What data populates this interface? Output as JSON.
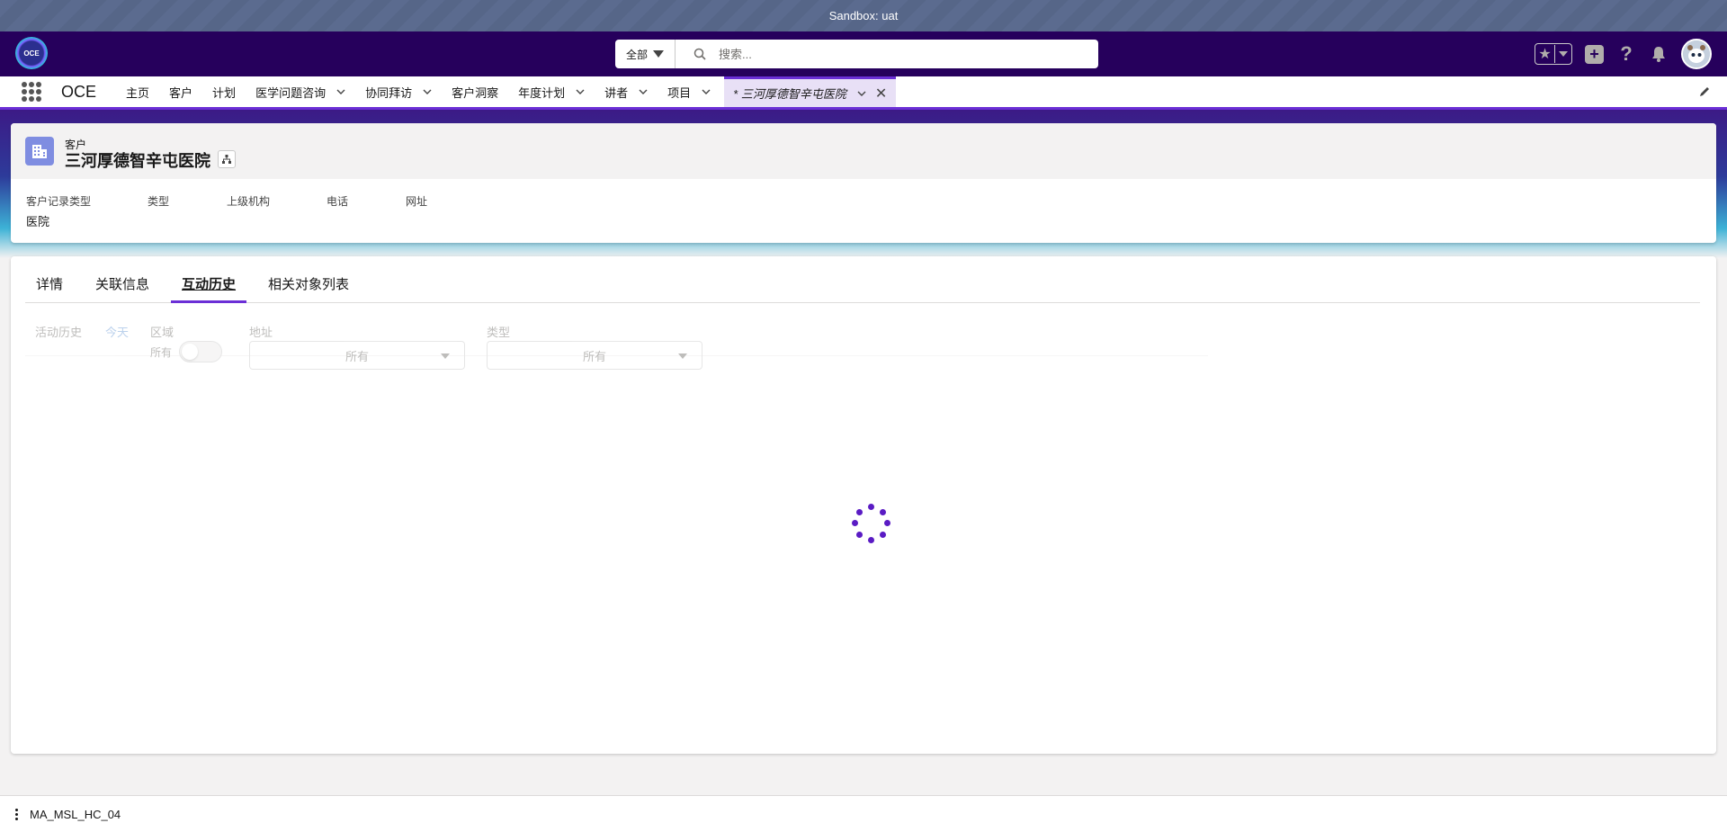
{
  "sandbox": {
    "label": "Sandbox: uat"
  },
  "global_header": {
    "logo_text": "OCE",
    "search": {
      "scope": "全部",
      "placeholder": "搜索..."
    },
    "icons": [
      "favorites-star-icon",
      "favorites-caret-icon",
      "global-actions-plus-icon",
      "help-icon",
      "notifications-bell-icon",
      "user-avatar"
    ]
  },
  "app_nav": {
    "app_name": "OCE",
    "items": [
      {
        "label": "主页",
        "has_menu": false
      },
      {
        "label": "客户",
        "has_menu": false
      },
      {
        "label": "计划",
        "has_menu": false
      },
      {
        "label": "医学问题咨询",
        "has_menu": true
      },
      {
        "label": "协同拜访",
        "has_menu": true
      },
      {
        "label": "客户洞察",
        "has_menu": false
      },
      {
        "label": "年度计划",
        "has_menu": true
      },
      {
        "label": "讲者",
        "has_menu": true
      },
      {
        "label": "项目",
        "has_menu": true
      }
    ],
    "active_tab": {
      "label": "* 三河厚德智辛屯医院"
    }
  },
  "record": {
    "object_type": "客户",
    "title": "三河厚德智辛屯医院",
    "highlights": [
      {
        "label": "客户记录类型",
        "value": "医院"
      },
      {
        "label": "类型",
        "value": ""
      },
      {
        "label": "上级机构",
        "value": ""
      },
      {
        "label": "电话",
        "value": ""
      },
      {
        "label": "网址",
        "value": ""
      }
    ]
  },
  "tabs": [
    {
      "label": "详情",
      "active": false
    },
    {
      "label": "关联信息",
      "active": false
    },
    {
      "label": "互动历史",
      "active": true
    },
    {
      "label": "相关对象列表",
      "active": false
    }
  ],
  "filters": {
    "activity_history_label": "活动历史",
    "today_link": "今天",
    "territory_label": "区域",
    "territory_toggle_text": "所有",
    "address_label": "地址",
    "address_value": "所有",
    "type_label": "类型",
    "type_value": "所有"
  },
  "utility_bar": {
    "label": "MA_MSL_HC_04"
  },
  "colors": {
    "brand_purple": "#26005c",
    "accent_purple": "#6b2fd6",
    "spinner": "#5a1bc4"
  }
}
